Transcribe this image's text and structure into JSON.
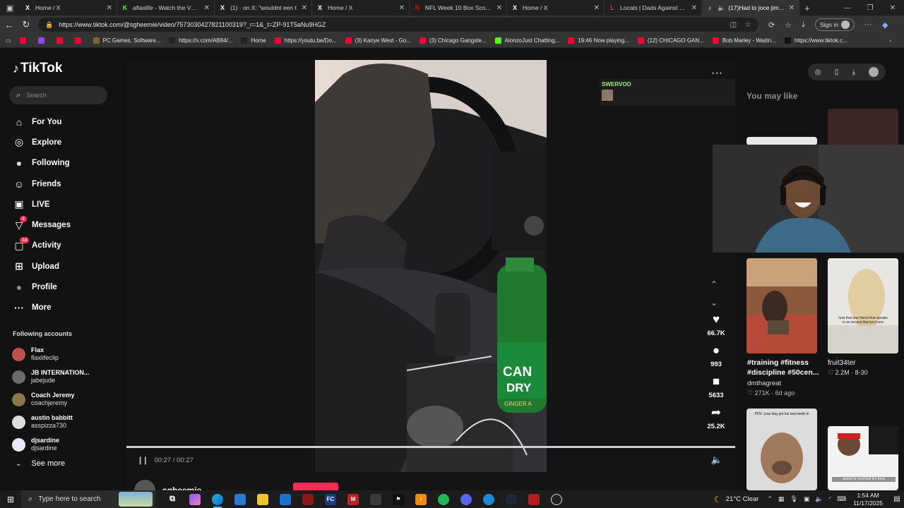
{
  "browser": {
    "tabs": [
      {
        "title": "Home / X",
        "fav": "X",
        "fav_color": "#ffffff",
        "active": false
      },
      {
        "title": "aflaxlife - Watch the VOD o",
        "fav": "K",
        "fav_color": "#53fc18",
        "active": false
      },
      {
        "title": "(1) · on X: \"wouldnt een t",
        "fav": "X",
        "fav_color": "#ffffff",
        "active": false
      },
      {
        "title": "Home / X",
        "fav": "X",
        "fav_color": "#ffffff",
        "active": false
      },
      {
        "title": "NFL Week 10 Box Score - D",
        "fav": "N",
        "fav_color": "#d50a0a",
        "active": false
      },
      {
        "title": "Home / X",
        "fav": "X",
        "fav_color": "#ffffff",
        "active": false
      },
      {
        "title": "Locals | Dads Against Preda",
        "fav": "L",
        "fav_color": "#e43f5a",
        "active": false
      },
      {
        "title": "(17)Had to joce jimmy",
        "fav": "♪",
        "fav_color": "#ffffff",
        "active": true
      }
    ],
    "url": "https://www.tiktok.com/@sgheemie/video/7573030427821100319?_r=1&_t=ZP-91T5aNu9HGZ",
    "signin_label": "Sign in",
    "bookmarks": [
      {
        "label": "",
        "color": "#ff0033"
      },
      {
        "label": "",
        "color": "#9146ff"
      },
      {
        "label": "",
        "color": "#ff0033"
      },
      {
        "label": "",
        "color": "#ff0033"
      },
      {
        "label": "PC Games, Software...",
        "color": "#7a6a2a"
      },
      {
        "label": "https://x.com/AB84/...",
        "color": "#222222"
      },
      {
        "label": "Home",
        "color": "#222222"
      },
      {
        "label": "https://youtu.be/Do...",
        "color": "#ff0033"
      },
      {
        "label": "(3) Kanye West - Go...",
        "color": "#ff0033"
      },
      {
        "label": "(3) Chicago Gangste...",
        "color": "#ff0033"
      },
      {
        "label": "AlonzoJust Chatting...",
        "color": "#53fc18"
      },
      {
        "label": "19:46 Now playing...",
        "color": "#ff0033"
      },
      {
        "label": "(12) CHICAGO GAN...",
        "color": "#ff0033"
      },
      {
        "label": "Bob Marley - Waitin...",
        "color": "#ff0033"
      },
      {
        "label": "https://www.tiktok.c...",
        "color": "#111111"
      }
    ]
  },
  "tiktok": {
    "logo": "TikTok",
    "search_placeholder": "Search",
    "nav": [
      {
        "label": "For You",
        "icon": "home-icon",
        "glyph": "⌂",
        "badge": ""
      },
      {
        "label": "Explore",
        "icon": "compass-icon",
        "glyph": "◎",
        "badge": ""
      },
      {
        "label": "Following",
        "icon": "following-avatar-icon",
        "glyph": "●",
        "badge": ""
      },
      {
        "label": "Friends",
        "icon": "friends-icon",
        "glyph": "☺",
        "badge": ""
      },
      {
        "label": "LIVE",
        "icon": "live-icon",
        "glyph": "▣",
        "badge": ""
      },
      {
        "label": "Messages",
        "icon": "messages-icon",
        "glyph": "▽",
        "badge": "3"
      },
      {
        "label": "Activity",
        "icon": "activity-icon",
        "glyph": "▢",
        "badge": "14"
      },
      {
        "label": "Upload",
        "icon": "upload-icon",
        "glyph": "⊞",
        "badge": ""
      },
      {
        "label": "Profile",
        "icon": "profile-avatar-icon",
        "glyph": "●",
        "badge": ""
      },
      {
        "label": "More",
        "icon": "more-icon",
        "glyph": "···",
        "badge": ""
      }
    ],
    "following_title": "Following accounts",
    "following_accounts": [
      {
        "name": "Flax",
        "handle": "flaxlifeclip",
        "color": "#c0504d"
      },
      {
        "name": "JB INTERNATION...",
        "handle": "jabejude",
        "color": "#6a6a6a"
      },
      {
        "name": "Coach Jeremy",
        "handle": "coachjeremy",
        "color": "#8a7a4a"
      },
      {
        "name": "austin babbitt",
        "handle": "asspizza730",
        "color": "#dddddd"
      },
      {
        "name": "djsardine",
        "handle": "djsardine",
        "color": "#e8e8f8"
      }
    ],
    "see_more": "See more",
    "player": {
      "time": "00:27 / 00:27",
      "progress": 1.0,
      "likes": "66.7K",
      "comments": "993",
      "saves": "5633",
      "shares": "25.2K",
      "username": "sgheemie"
    },
    "overlay": {
      "label": "SWERVOO",
      "k_icon": "K"
    },
    "you_may_like": "You may like",
    "recommendations": [
      {
        "caption": "#training #fitness #discipline #50cen...",
        "user": "dmthagreat",
        "likes": "271K",
        "age": "6d ago"
      },
      {
        "caption": "",
        "user": "fruit34ter",
        "likes": "2.2M",
        "age": "8-30"
      }
    ],
    "thumb_texts": {
      "ponytail": "how that one friend that speaks in an accent that isn't hers",
      "dog": "POV: your dog got his new teeth in",
      "bottom_right": "assist is cool but it's time"
    }
  },
  "taskbar": {
    "search_placeholder": "Type here to search",
    "weather": "21°C  Clear",
    "time": "1:54 AM",
    "date": "11/17/2025"
  }
}
